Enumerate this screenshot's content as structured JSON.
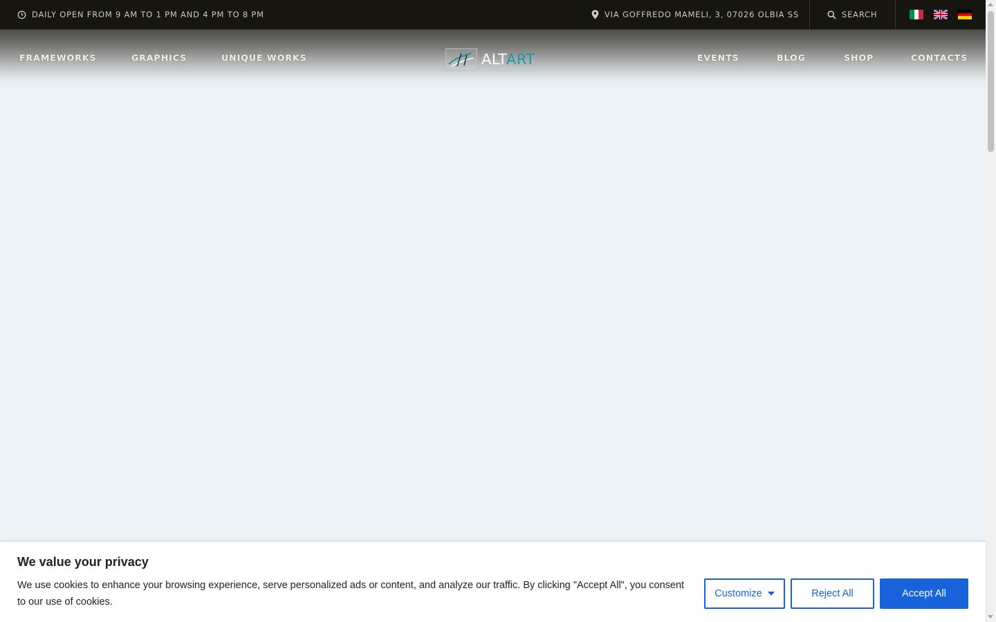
{
  "topbar": {
    "hours": "DAILY OPEN FROM 9 AM TO 1 PM AND 4 PM TO 8 PM",
    "address": "VIA GOFFREDO MAMELI, 3, 07026 OLBIA SS",
    "search_label": "SEARCH",
    "languages": [
      "it-flag-icon",
      "en-flag-icon",
      "de-flag-icon"
    ]
  },
  "nav": {
    "left": [
      "FRAMEWORKS",
      "GRAPHICS",
      "UNIQUE WORKS"
    ],
    "right": [
      "EVENTS",
      "BLOG",
      "SHOP",
      "CONTACTS"
    ]
  },
  "logo": {
    "part1": "ALT",
    "part2": "ART"
  },
  "cookie": {
    "title": "We value your privacy",
    "text": "We use cookies to enhance your browsing experience, serve personalized ads or content, and analyze our traffic. By clicking \"Accept All\", you consent to our use of cookies.",
    "customize": "Customize",
    "reject": "Reject All",
    "accept": "Accept All"
  },
  "colors": {
    "topbar_bg": "#16150f",
    "accent_teal": "#1a9aa0",
    "button_blue": "#1863dc",
    "page_bg": "#ecf3f6"
  }
}
